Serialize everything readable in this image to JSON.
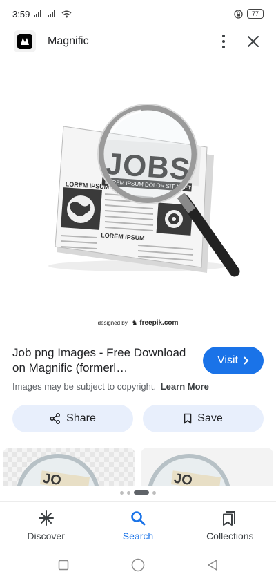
{
  "status_bar": {
    "time": "3:59",
    "battery": "77"
  },
  "header": {
    "app_name": "Magnific",
    "logo_icon": "magnific-logo-icon",
    "more_icon": "more-vert-icon",
    "close_icon": "close-icon"
  },
  "image": {
    "headline_text": "JOBS",
    "strap_text": "LOREM IPSUM DOLOR SIT AMET",
    "column_text_1": "LOREM IPSUM",
    "column_text_2": "LOREM IPSUM",
    "credit_prefix": "designed by",
    "credit_name": "freepik.com"
  },
  "result": {
    "title": "Job png Images - Free Download on Magnific (formerl…",
    "visit_label": "Visit",
    "copyright_text": "Images may be subject to copyright.",
    "learn_more_label": "Learn More"
  },
  "actions": {
    "share_label": "Share",
    "save_label": "Save"
  },
  "bottom_nav": {
    "items": [
      {
        "label": "Discover",
        "icon": "discover-icon"
      },
      {
        "label": "Search",
        "icon": "search-icon",
        "active": true
      },
      {
        "label": "Collections",
        "icon": "collections-icon"
      }
    ]
  },
  "colors": {
    "accent": "#1a73e8",
    "pill_bg": "#e8effc"
  }
}
